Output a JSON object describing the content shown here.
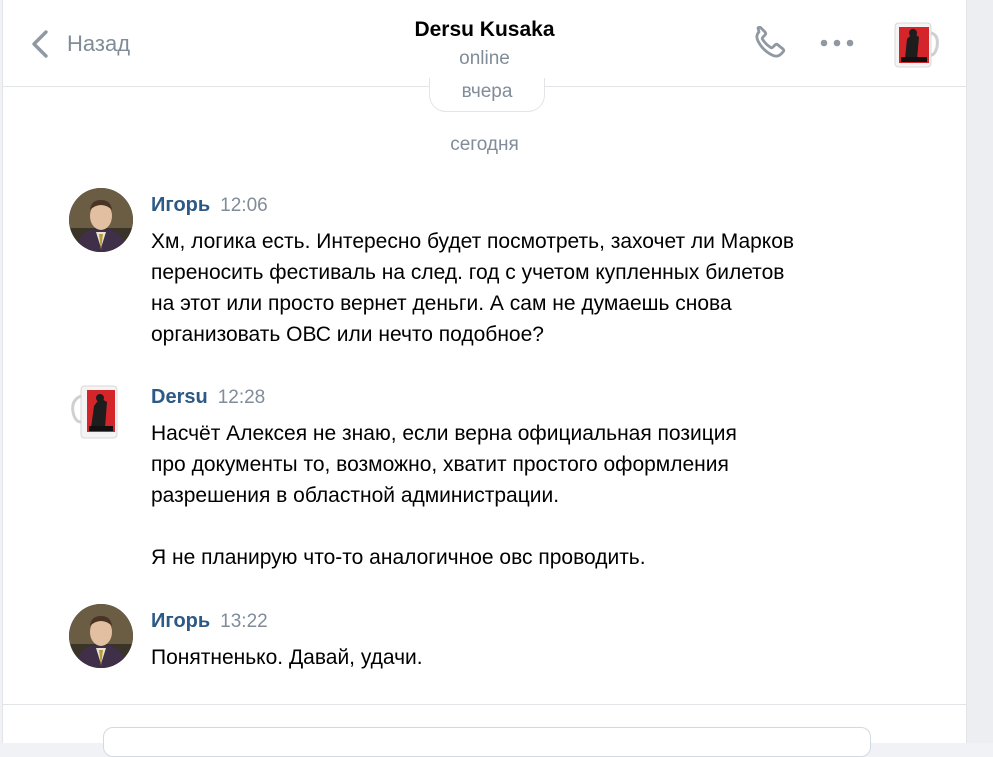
{
  "header": {
    "back_label": "Назад",
    "title": "Dersu Kusaka",
    "status": "online"
  },
  "dates": {
    "previous": "вчера",
    "today": "сегодня"
  },
  "messages": [
    {
      "author": "Игорь",
      "time": "12:06",
      "paragraphs": [
        "Хм, логика есть. Интересно будет посмотреть, захочет ли Марков переносить фестиваль на след. год с учетом купленных билетов на этот или просто вернет деньги. А сам не думаешь снова организовать ОВС или нечто подобное?"
      ]
    },
    {
      "author": "Dersu",
      "time": "12:28",
      "paragraphs": [
        "Насчёт Алексея не знаю, если верна официальная позиция про документы то, возможно, хватит простого оформления разрешения в областной администрации.",
        "Я не планирую что-то аналогичное овс проводить."
      ]
    },
    {
      "author": "Игорь",
      "time": "13:22",
      "paragraphs": [
        "Понятненько. Давай, удачи."
      ]
    }
  ],
  "icons": {
    "back": "chevron-left-icon",
    "call": "phone-icon",
    "more": "more-dots-icon"
  },
  "colors": {
    "author": "#2c5986",
    "muted": "#818c99",
    "divider": "#e3e4e8"
  }
}
